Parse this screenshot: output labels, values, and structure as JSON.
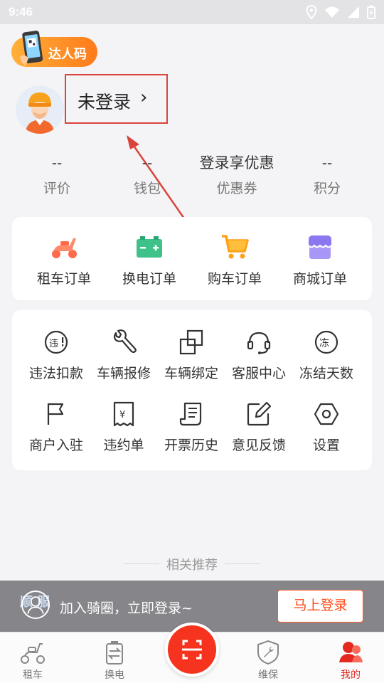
{
  "status_bar": {
    "time": "9:46"
  },
  "expert_badge": {
    "label": "达人码"
  },
  "profile": {
    "login_text": "未登录",
    "chevron": "›"
  },
  "stats": [
    {
      "value": "--",
      "label": "评价"
    },
    {
      "value": "--",
      "label": "钱包"
    },
    {
      "value": "登录享优惠",
      "label": "优惠券"
    },
    {
      "value": "--",
      "label": "积分"
    }
  ],
  "orders": [
    {
      "label": "租车订单",
      "icon": "scooter-icon"
    },
    {
      "label": "换电订单",
      "icon": "battery-icon"
    },
    {
      "label": "购车订单",
      "icon": "cart-icon"
    },
    {
      "label": "商城订单",
      "icon": "shop-icon"
    }
  ],
  "tools_row1": [
    {
      "label": "违法扣款",
      "icon": "violation-icon"
    },
    {
      "label": "车辆报修",
      "icon": "wrench-icon"
    },
    {
      "label": "车辆绑定",
      "icon": "bind-icon"
    },
    {
      "label": "客服中心",
      "icon": "headset-icon"
    },
    {
      "label": "冻结天数",
      "icon": "freeze-icon"
    }
  ],
  "tools_row2": [
    {
      "label": "商户入驻",
      "icon": "flag-icon"
    },
    {
      "label": "违约单",
      "icon": "receipt-icon"
    },
    {
      "label": "开票历史",
      "icon": "invoice-icon"
    },
    {
      "label": "意见反馈",
      "icon": "edit-icon"
    },
    {
      "label": "设置",
      "icon": "settings-icon"
    }
  ],
  "recommend": {
    "title": "相关推荐"
  },
  "login_banner": {
    "text": "加入骑圈，立即登录~",
    "button": "马上登录",
    "bg_text": "顺 服"
  },
  "tab_bar": [
    {
      "label": "租车",
      "icon": "scooter-tab-icon",
      "active": false
    },
    {
      "label": "换电",
      "icon": "swap-battery-tab-icon",
      "active": false
    },
    {
      "label": "维保",
      "icon": "maintenance-tab-icon",
      "active": false
    },
    {
      "label": "我的",
      "icon": "profile-tab-icon",
      "active": true
    }
  ],
  "colors": {
    "accent": "#f5331e",
    "orange": "#ff7a1a",
    "annotation": "#d9443c"
  }
}
